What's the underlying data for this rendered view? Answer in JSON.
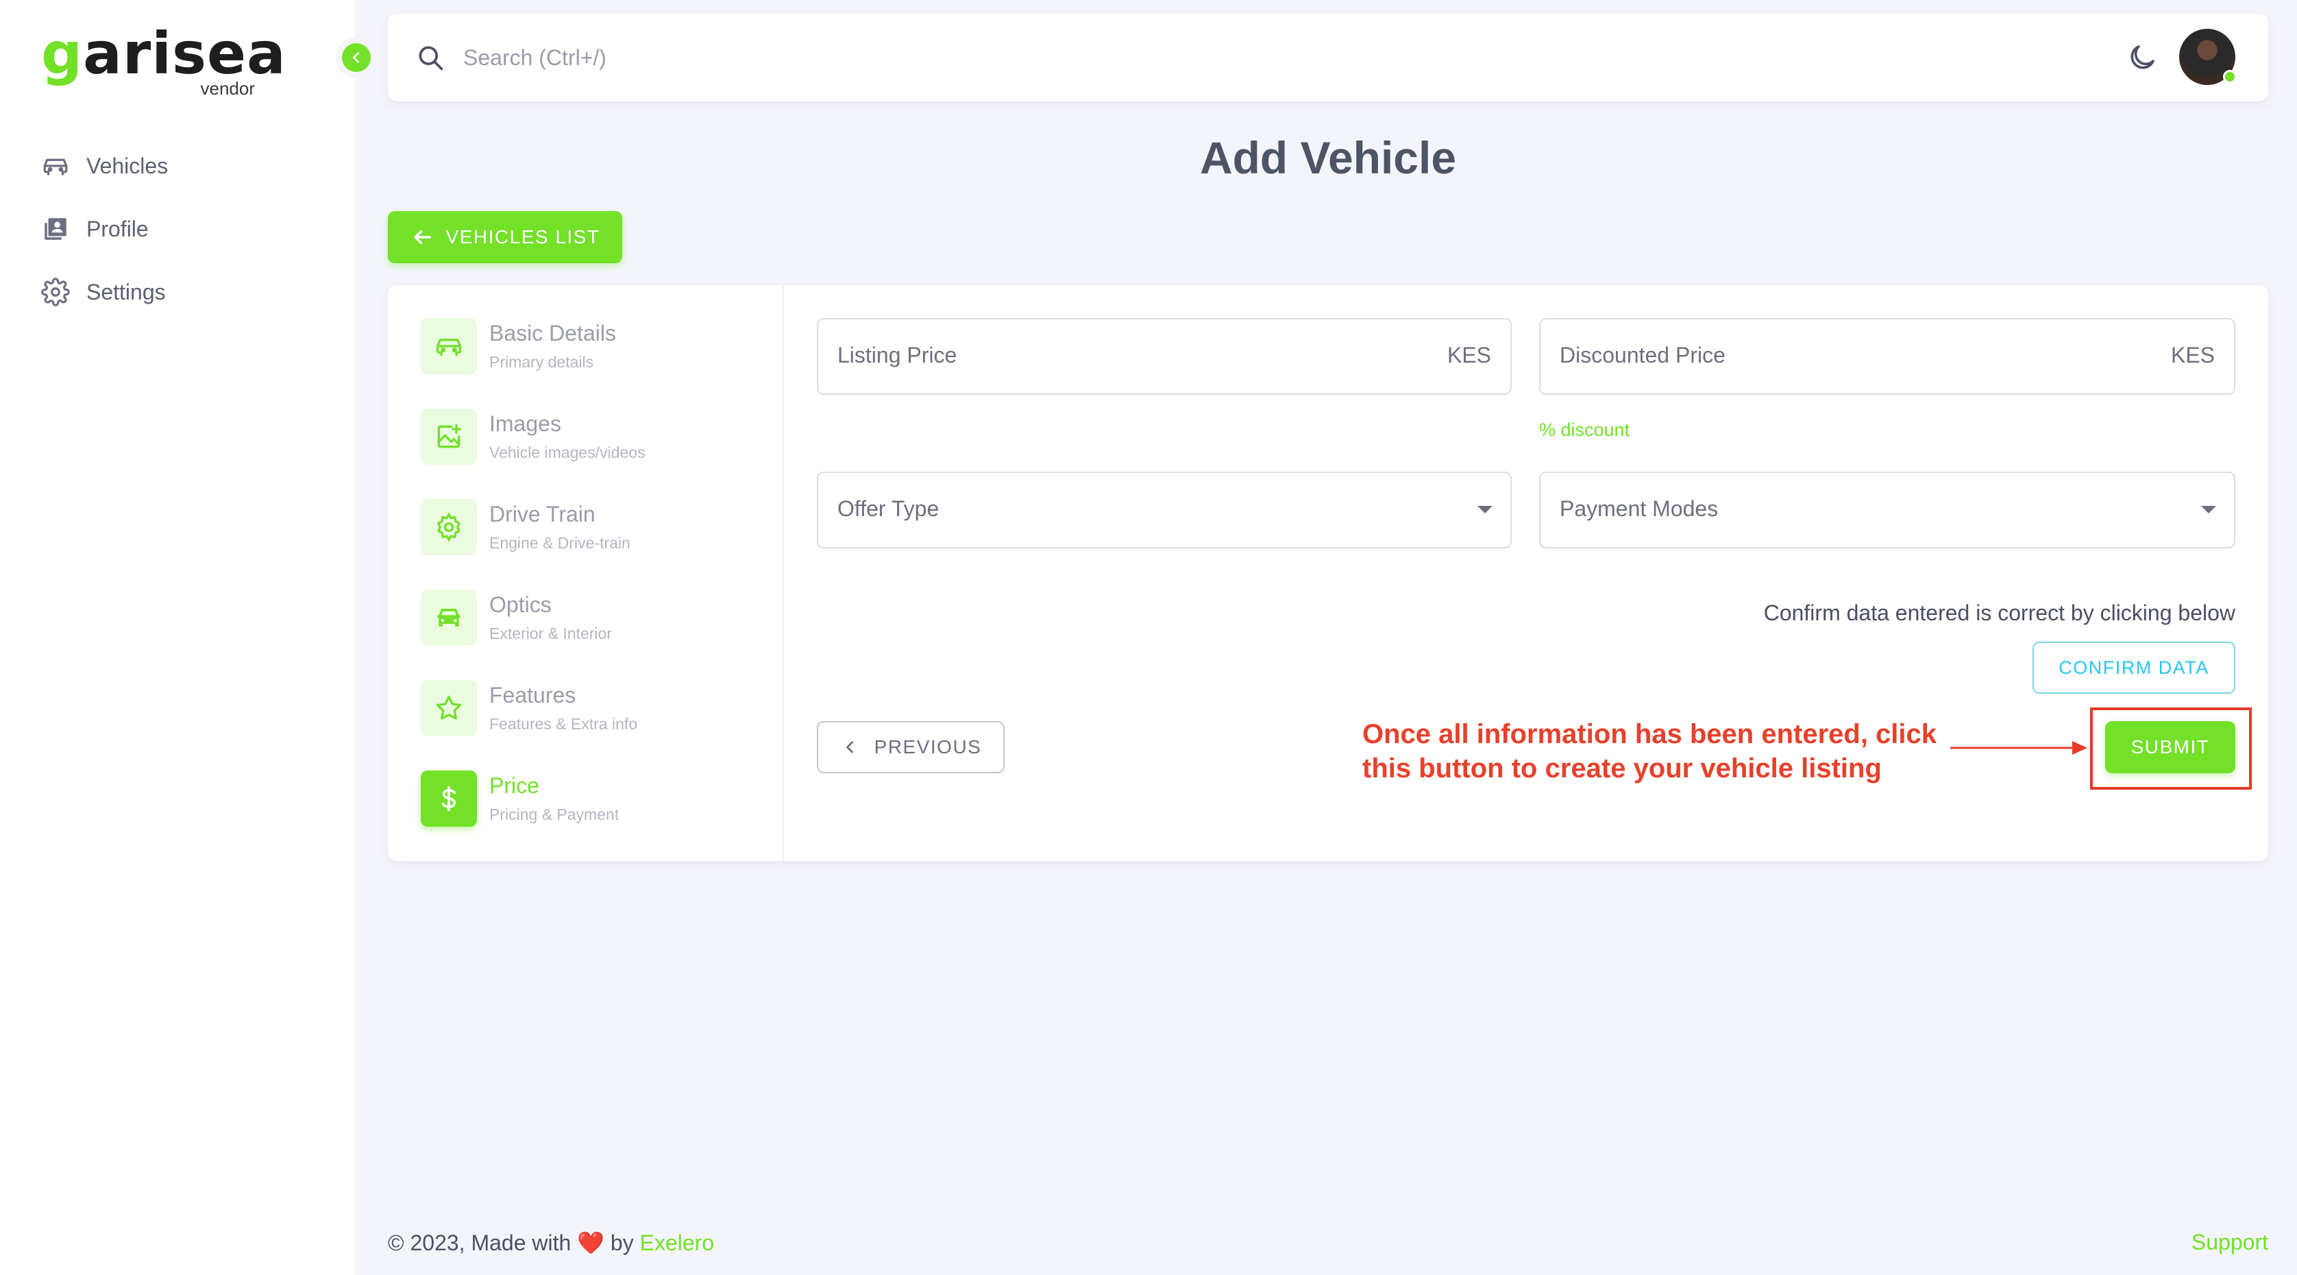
{
  "brand": {
    "name_first": "g",
    "name_rest": "arisea",
    "subtitle": "vendor",
    "accent": "#72e128"
  },
  "sidebar": {
    "items": [
      {
        "label": "Vehicles",
        "icon": "car-icon"
      },
      {
        "label": "Profile",
        "icon": "profile-icon"
      },
      {
        "label": "Settings",
        "icon": "gear-icon"
      }
    ]
  },
  "topbar": {
    "search_placeholder": "Search (Ctrl+/)"
  },
  "page": {
    "title": "Add Vehicle",
    "back_label": "VEHICLES LIST"
  },
  "steps": [
    {
      "title": "Basic Details",
      "subtitle": "Primary details",
      "icon": "car-icon",
      "active": false
    },
    {
      "title": "Images",
      "subtitle": "Vehicle images/videos",
      "icon": "image-add-icon",
      "active": false
    },
    {
      "title": "Drive Train",
      "subtitle": "Engine & Drive-train",
      "icon": "gear-icon",
      "active": false
    },
    {
      "title": "Optics",
      "subtitle": "Exterior & Interior",
      "icon": "car-front-icon",
      "active": false
    },
    {
      "title": "Features",
      "subtitle": "Features & Extra info",
      "icon": "star-icon",
      "active": false
    },
    {
      "title": "Price",
      "subtitle": "Pricing & Payment",
      "icon": "dollar-icon",
      "active": true
    }
  ],
  "form": {
    "listing_price": {
      "label": "Listing Price",
      "suffix": "KES",
      "value": ""
    },
    "discounted_price": {
      "label": "Discounted Price",
      "suffix": "KES",
      "value": ""
    },
    "discount_hint": "% discount",
    "offer_type": {
      "label": "Offer Type",
      "value": ""
    },
    "payment_modes": {
      "label": "Payment Modes",
      "value": ""
    },
    "confirm_text": "Confirm data entered is correct by clicking below",
    "confirm_label": "CONFIRM DATA",
    "previous_label": "PREVIOUS",
    "submit_label": "SUBMIT"
  },
  "annotation": {
    "line1": "Once all information has been entered, click",
    "line2": "this button to create your vehicle listing",
    "color": "#e8402a"
  },
  "footer": {
    "copyright": "© 2023, Made with",
    "heart": "❤️",
    "by": "by",
    "company": "Exelero",
    "support": "Support"
  }
}
